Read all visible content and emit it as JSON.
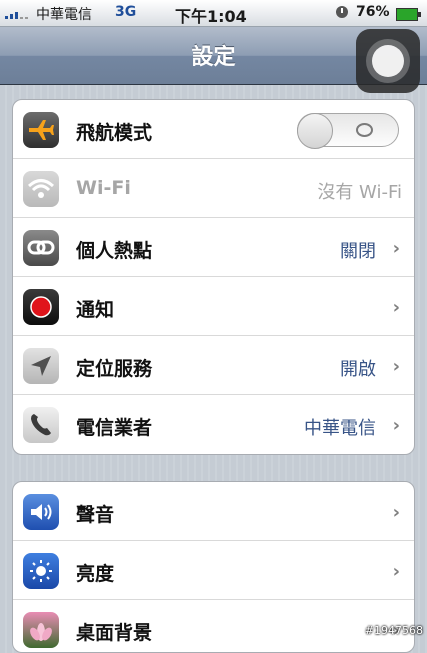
{
  "status": {
    "carrier": "中華電信",
    "network": "3G",
    "time": "下午1:04",
    "battery": "76%"
  },
  "navbar": {
    "title": "設定"
  },
  "group1": [
    {
      "label": "飛航模式",
      "icon": "airplane-icon",
      "type": "toggle",
      "toggle_on": false
    },
    {
      "label": "Wi-Fi",
      "icon": "wifi-icon",
      "value": "沒有 Wi-Fi",
      "disabled": true
    },
    {
      "label": "個人熱點",
      "icon": "hotspot-link-icon",
      "value": "關閉",
      "chevron": "›"
    },
    {
      "label": "通知",
      "icon": "notifications-icon",
      "value": "",
      "chevron": "›"
    },
    {
      "label": "定位服務",
      "icon": "location-arrow-icon",
      "value": "開啟",
      "chevron": "›"
    },
    {
      "label": "電信業者",
      "icon": "phone-icon",
      "value": "中華電信",
      "chevron": "›"
    }
  ],
  "group2": [
    {
      "label": "聲音",
      "icon": "speaker-icon",
      "chevron": "›"
    },
    {
      "label": "亮度",
      "icon": "brightness-sun-icon",
      "chevron": "›"
    },
    {
      "label": "桌面背景",
      "icon": "wallpaper-flower-icon",
      "chevron": "›"
    }
  ],
  "watermark": "#1947568",
  "colors": {
    "value_blue": "#385487",
    "nav_bar": "#6d7f98",
    "background": "#c5ccd4"
  }
}
